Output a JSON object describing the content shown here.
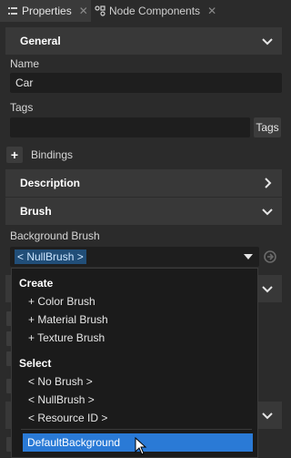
{
  "tabs": [
    {
      "label": "Properties",
      "close": "✕",
      "icon": "properties-icon"
    },
    {
      "label": "Node Components",
      "close": "✕",
      "icon": "node-components-icon"
    }
  ],
  "sections": {
    "general": {
      "title": "General",
      "chevron": "chevron-down-icon"
    },
    "description": {
      "title": "Description",
      "chevron": "chevron-right-icon"
    },
    "brush": {
      "title": "Brush",
      "chevron": "chevron-down-icon"
    }
  },
  "fields": {
    "name_label": "Name",
    "name_value": "Car",
    "tags_label": "Tags",
    "tags_value": "",
    "tags_button": "Tags",
    "bindings_button": "+",
    "bindings_label": "Bindings",
    "background_brush_label": "Background Brush",
    "background_brush_value": "< NullBrush >"
  },
  "popup": {
    "create_title": "Create",
    "create_items": [
      "+ Color Brush",
      "+ Material Brush",
      "+ Texture Brush"
    ],
    "select_title": "Select",
    "select_items": [
      "< No Brush >",
      "< NullBrush >",
      "< Resource ID >"
    ],
    "highlighted_item": "DefaultBackground"
  },
  "colors": {
    "accent": "#2a7ad6",
    "selection_bg": "#214e78",
    "panel_bg": "#2b2b2b",
    "header_bg": "#383838",
    "field_bg": "#1e1e1e"
  }
}
